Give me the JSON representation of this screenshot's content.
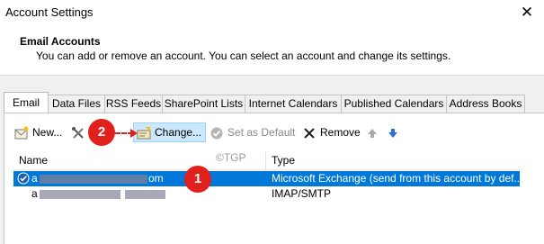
{
  "window": {
    "title": "Account Settings",
    "close_glyph": "✕"
  },
  "header": {
    "title": "Email Accounts",
    "description": "You can add or remove an account. You can select an account and change its settings."
  },
  "tabs": [
    {
      "label": "Email",
      "active": true
    },
    {
      "label": "Data Files"
    },
    {
      "label": "RSS Feeds"
    },
    {
      "label": "SharePoint Lists"
    },
    {
      "label": "Internet Calendars"
    },
    {
      "label": "Published Calendars"
    },
    {
      "label": "Address Books"
    }
  ],
  "toolbar": {
    "new_label": "New...",
    "change_label": "Change...",
    "set_default_label": "Set as Default",
    "remove_label": "Remove",
    "icons": [
      "new-mail-icon",
      "repair-tools-icon",
      "change-card-icon",
      "check-circle-icon",
      "remove-x-icon",
      "move-up-arrow-icon",
      "move-down-arrow-icon"
    ]
  },
  "table": {
    "columns": [
      "Name",
      "Type"
    ],
    "rows": [
      {
        "name": "a",
        "name_suffix": "om",
        "type": "Microsoft Exchange (send from this account by def...",
        "selected": true,
        "is_default": true
      },
      {
        "name": "a",
        "name_suffix": "",
        "type": "IMAP/SMTP",
        "selected": false
      }
    ]
  },
  "annotations": {
    "marker1": "1",
    "marker2": "2",
    "watermark": "©TGP"
  },
  "colors": {
    "selection": "#0078d7",
    "marker": "#e0201c",
    "hover": "#cce8ff"
  }
}
